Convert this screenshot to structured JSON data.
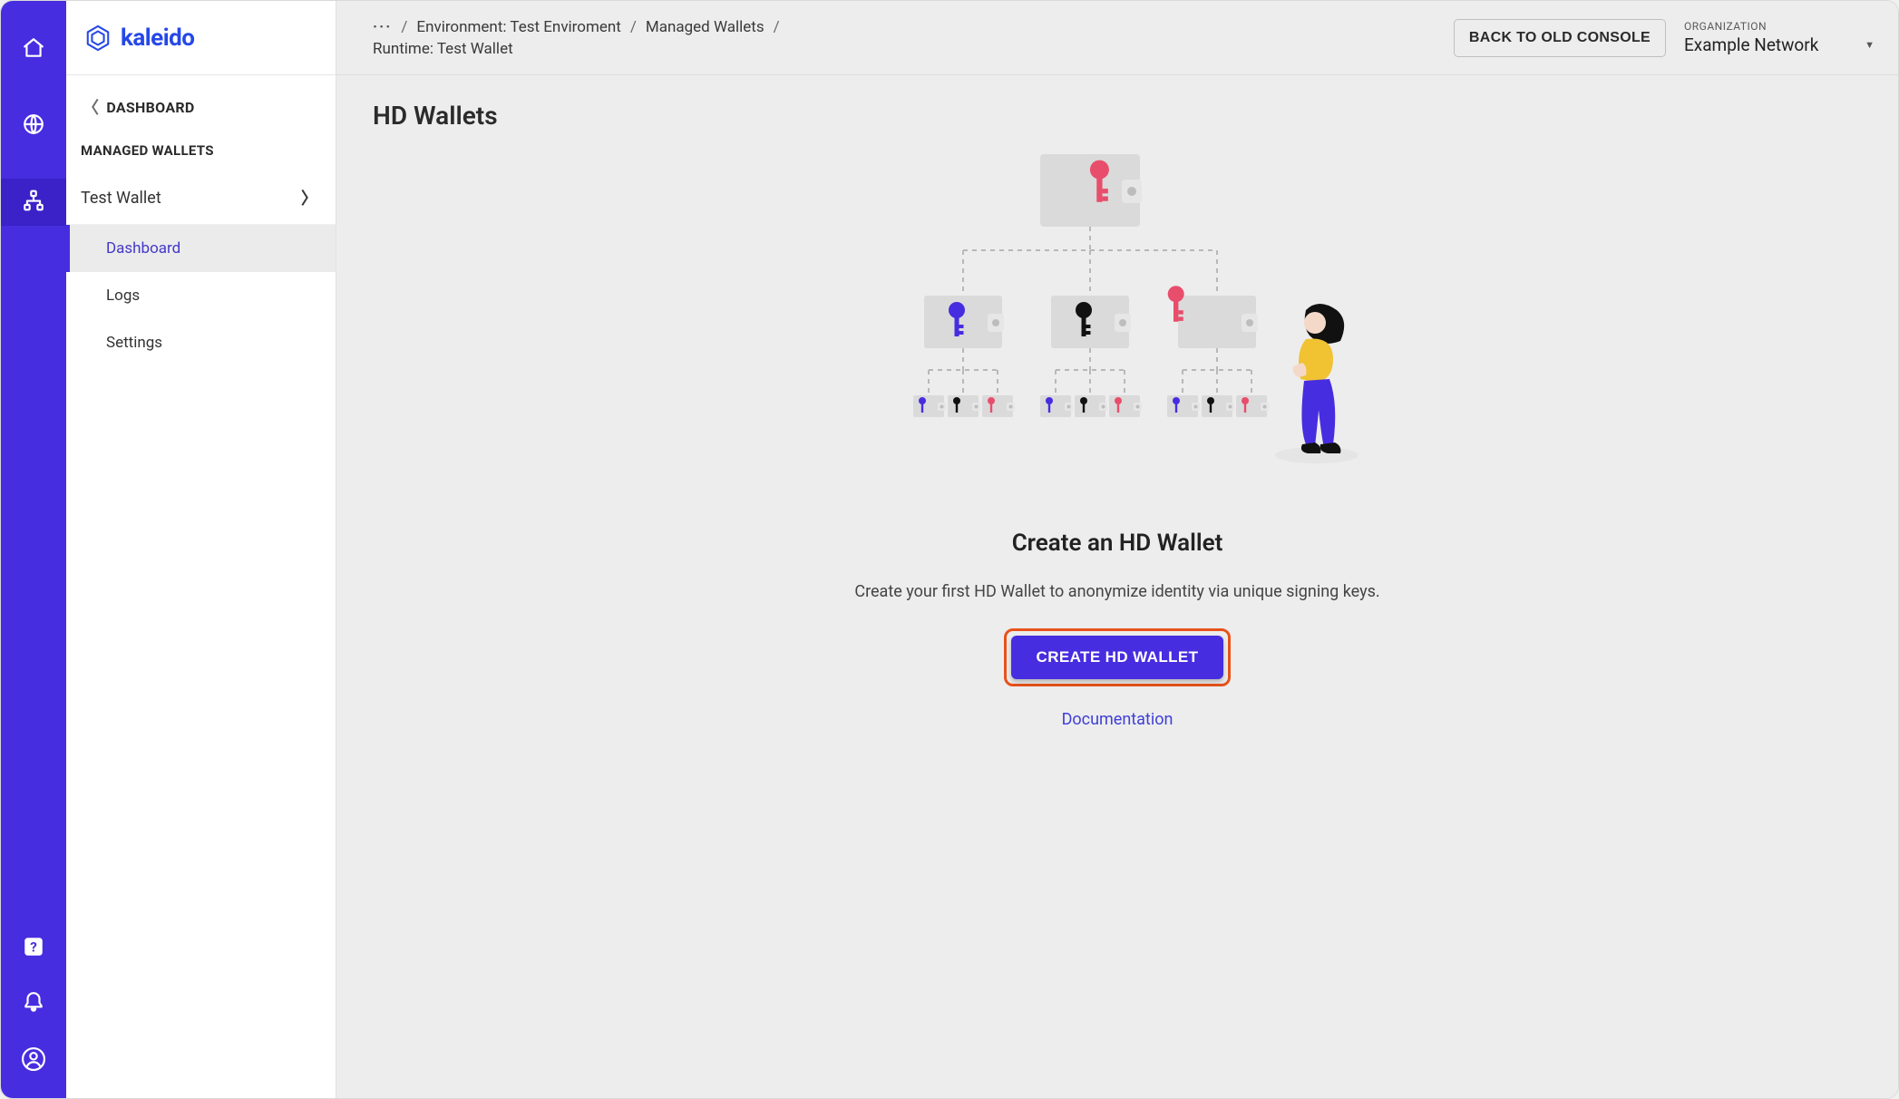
{
  "brand": {
    "name": "kaleido"
  },
  "rail": {
    "items": [
      {
        "name": "home-icon"
      },
      {
        "name": "globe-icon"
      },
      {
        "name": "network-icon",
        "active": true
      }
    ],
    "bottom": [
      {
        "name": "help-icon"
      },
      {
        "name": "bell-icon"
      },
      {
        "name": "user-icon"
      }
    ]
  },
  "sidebar": {
    "back_label": "DASHBOARD",
    "section_label": "MANAGED WALLETS",
    "wallet_name": "Test Wallet",
    "items": [
      {
        "key": "dashboard",
        "label": "Dashboard",
        "active": true
      },
      {
        "key": "logs",
        "label": "Logs",
        "active": false
      },
      {
        "key": "settings",
        "label": "Settings",
        "active": false
      }
    ]
  },
  "header": {
    "breadcrumb": {
      "more": "···",
      "env": "Environment: Test Enviroment",
      "category": "Managed Wallets",
      "runtime": "Runtime: Test Wallet"
    },
    "back_button": "BACK TO OLD CONSOLE",
    "org_label": "ORGANIZATION",
    "org_value": "Example Network"
  },
  "page": {
    "title": "HD Wallets",
    "hero_title": "Create an HD Wallet",
    "hero_sub": "Create your first HD Wallet to anonymize identity via unique signing keys.",
    "create_label": "CREATE HD WALLET",
    "doc_label": "Documentation"
  },
  "colors": {
    "primary": "#462de0",
    "highlight_ring": "#e8521b",
    "key_red": "#e84e6c",
    "key_blue": "#462de0",
    "key_black": "#111111",
    "wallet_grey": "#dadada",
    "wallet_dot": "#bdbdbd"
  }
}
